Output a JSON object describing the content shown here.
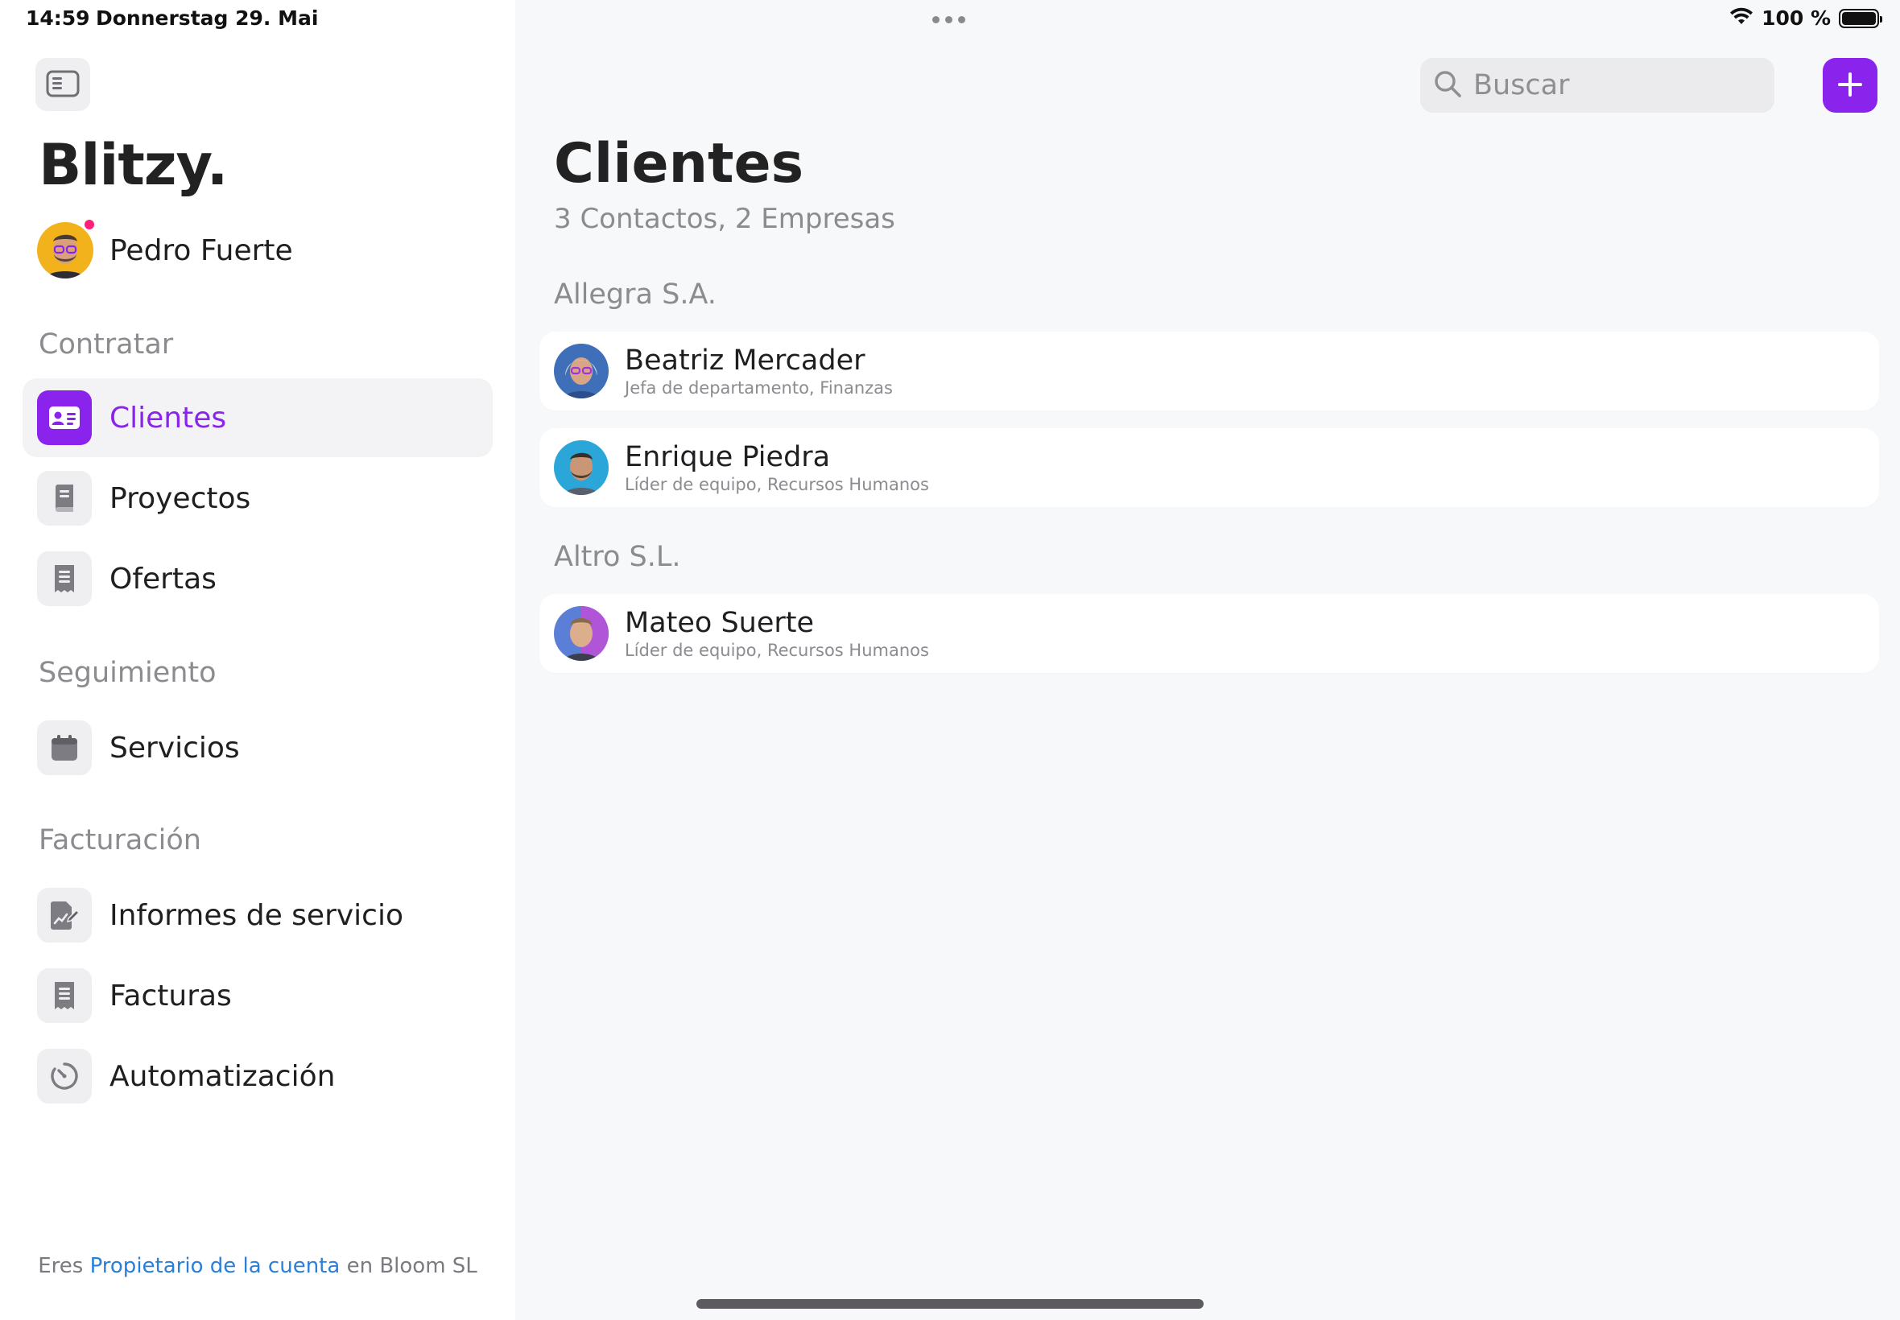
{
  "status_bar": {
    "time": "14:59",
    "date": "Donnerstag 29. Mai",
    "battery_text": "100 %",
    "battery_level": 1.0
  },
  "sidebar": {
    "toggle_icon": "sidebar-toggle-icon",
    "brand": "Blitzy.",
    "user": {
      "name": "Pedro Fuerte",
      "has_notification": true,
      "notification_color": "#ff1e78"
    },
    "sections": [
      {
        "label": "Contratar",
        "items": [
          {
            "label": "Clientes",
            "icon": "contact-card-icon",
            "active": true
          },
          {
            "label": "Proyectos",
            "icon": "book-icon",
            "active": false
          },
          {
            "label": "Ofertas",
            "icon": "receipt-icon",
            "active": false
          }
        ]
      },
      {
        "label": "Seguimiento",
        "items": [
          {
            "label": "Servicios",
            "icon": "calendar-icon",
            "active": false
          }
        ]
      },
      {
        "label": "Facturación",
        "items": [
          {
            "label": "Informes de servicio",
            "icon": "report-edit-icon",
            "active": false
          },
          {
            "label": "Facturas",
            "icon": "receipt-icon",
            "active": false
          },
          {
            "label": "Automatización",
            "icon": "timer-icon",
            "active": false
          }
        ]
      }
    ],
    "footer": {
      "prefix": "Eres",
      "link": "Propietario de la cuenta",
      "suffix": "en Bloom SL"
    }
  },
  "main": {
    "search": {
      "placeholder": "Buscar",
      "value": ""
    },
    "add_button_icon": "plus-icon",
    "title": "Clientes",
    "subtitle": "3 Contactos, 2 Empresas",
    "groups": [
      {
        "company": "Allegra S.A.",
        "contacts": [
          {
            "name": "Beatriz Mercader",
            "role": "Jefa de departamento, Finanzas"
          },
          {
            "name": "Enrique Piedra",
            "role": "Líder de equipo, Recursos Humanos"
          }
        ]
      },
      {
        "company": "Altro S.L.",
        "contacts": [
          {
            "name": "Mateo Suerte",
            "role": "Líder de equipo, Recursos Humanos"
          }
        ]
      }
    ]
  },
  "colors": {
    "accent": "#8a24ec",
    "link": "#2b7fd8",
    "muted_text": "#8b8b90",
    "background": "#f7f8fa"
  }
}
